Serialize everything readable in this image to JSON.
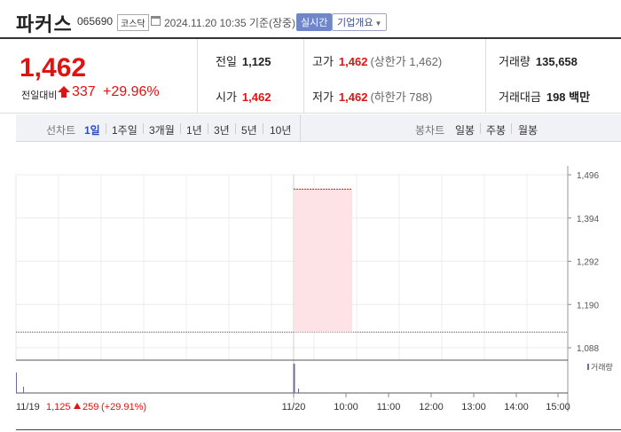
{
  "header": {
    "name": "파커스",
    "code": "065690",
    "market": "코스닥",
    "datetime": "2024.11.20 10:35",
    "basis": "기준(장중)",
    "realtime_label": "실시간",
    "company_label": "기업개요"
  },
  "price": {
    "current": "1,462",
    "vs_label": "전일대비",
    "diff": "337",
    "pct": "+29.96%"
  },
  "stats": {
    "prev_close": {
      "label": "전일",
      "value": "1,125"
    },
    "high": {
      "label": "고가",
      "value": "1,462",
      "sub": "(상한가 1,462)"
    },
    "volume": {
      "label": "거래량",
      "value": "135,658"
    },
    "open": {
      "label": "시가",
      "value": "1,462"
    },
    "low": {
      "label": "저가",
      "value": "1,462",
      "sub": "(하한가 788)"
    },
    "amount": {
      "label": "거래대금",
      "value": "198 백만"
    }
  },
  "tabs": {
    "line_label": "선차트",
    "line_periods": [
      "1일",
      "1주일",
      "3개월",
      "1년",
      "3년",
      "5년",
      "10년"
    ],
    "active_period": "1일",
    "candle_label": "봉차트",
    "candle_periods": [
      "일봉",
      "주봉",
      "월봉"
    ]
  },
  "chart_data": {
    "type": "line",
    "price_ticks": [
      "1,496",
      "1,394",
      "1,292",
      "1,190",
      "1,088"
    ],
    "price_tick_values": [
      1496,
      1394,
      1292,
      1190,
      1088
    ],
    "x_ticks": [
      "11/19",
      "11/20",
      "10:00",
      "11:00",
      "12:00",
      "13:00",
      "14:00",
      "15:00"
    ],
    "prev_close": 1125,
    "range_low": 1125,
    "range_high": 1462,
    "volume_label": "거래량",
    "footer": {
      "date": "11/19",
      "close": "1,125",
      "change": "259",
      "pct": "(+29.91%)"
    },
    "colors": {
      "up": "#e01212",
      "band": "#fde3e6",
      "volume": "#6b6b9a"
    }
  }
}
